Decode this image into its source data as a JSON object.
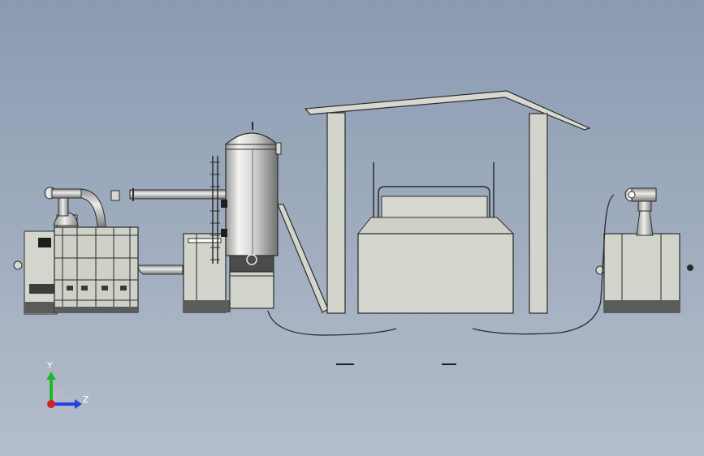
{
  "viewport": {
    "background_top": "#8a9bb1",
    "background_bottom": "#b4bdcb"
  },
  "model": {
    "line_color": "#2b2b2b",
    "body_color": "#d7d8cf",
    "shadow_color": "#5a5c5a"
  },
  "triad": {
    "y_label": "Y",
    "z_label": "Z",
    "x_color": "#d42020",
    "y_color": "#22b530",
    "z_color": "#2244dd"
  }
}
